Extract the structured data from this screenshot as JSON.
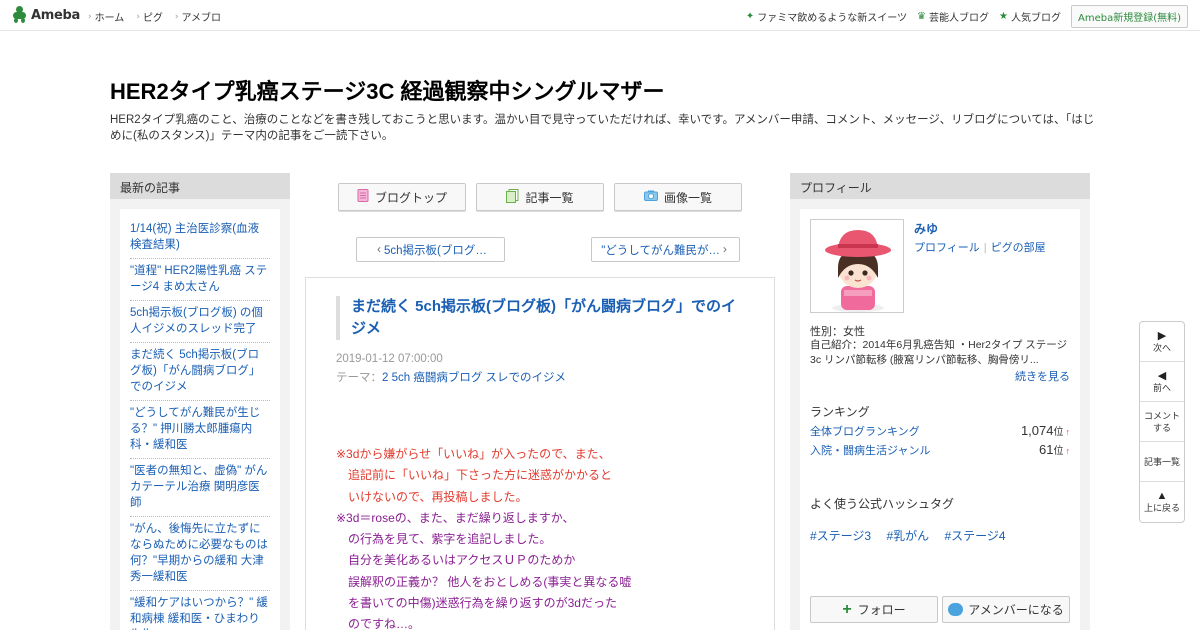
{
  "header": {
    "logo": "Ameba",
    "nav": [
      {
        "label": "ホーム"
      },
      {
        "label": "ピグ"
      },
      {
        "label": "アメブロ"
      }
    ],
    "right_links": [
      {
        "label": "ファミマ飲めるような新スイーツ",
        "icon": "sparkle-icon"
      },
      {
        "label": "芸能人ブログ",
        "icon": "crown-icon"
      },
      {
        "label": "人気ブログ",
        "icon": "star-icon"
      }
    ],
    "signup_label": "Ameba新規登録(無料)"
  },
  "blog": {
    "title": "HER2タイプ乳癌ステージ3C 経過観察中シングルマザー",
    "description": "HER2タイプ乳癌のこと、治療のことなどを書き残しておこうと思います。温かい目で見守っていただければ、幸いです。アメンバー申請、コメント、メッセージ、リブログについては、「はじめに(私のスタンス)」テーマ内の記事をご一読下さい。"
  },
  "sidebar_left": {
    "heading": "最新の記事",
    "items": [
      {
        "label": "1/14(祝) 主治医診察(血液検査結果)"
      },
      {
        "label": "\"道程\" HER2陽性乳癌 ステージ4 まめ太さん"
      },
      {
        "label": "5ch掲示板(ブログ板) の個人イジメのスレッド完了"
      },
      {
        "label": "まだ続く 5ch掲示板(ブログ板)「がん闘病ブログ」でのイジメ"
      },
      {
        "label": "\"どうしてがん難民が生じる？\" 押川勝太郎腫瘍内科・緩和医"
      },
      {
        "label": "\"医者の無知と、虚偽\" がんカテーテル治療 関明彦医師"
      },
      {
        "label": "\"がん、後悔先に立たずにならぬために必要なものは何？\"早期からの緩和 大津秀一緩和医"
      },
      {
        "label": "\"緩和ケアはいつから？\" 緩和病棟 緩和医・ひまわり先生"
      }
    ]
  },
  "toolbar": {
    "buttons": [
      {
        "label": "ブログトップ",
        "icon": "document-icon"
      },
      {
        "label": "記事一覧",
        "icon": "list-icon"
      },
      {
        "label": "画像一覧",
        "icon": "camera-icon"
      }
    ],
    "prev_label": "5ch掲示板(ブログ…",
    "next_label": "\"どうしてがん難民が…"
  },
  "article": {
    "title": "まだ続く 5ch掲示板(ブログ板)「がん闘病ブログ」でのイジメ",
    "date": "2019-01-12 07:00:00",
    "theme_prefix": "テーマ：",
    "theme": "2 5ch 癌闘病ブログ スレでのイジメ",
    "red_lines": [
      "※3dから嫌がらせ「いいね」が入ったので、また、",
      "　追記前に「いいね」下さった方に迷惑がかかると",
      "　いけないので、再投稿しました。"
    ],
    "purple_lines": [
      "※3d＝roseの、また、まだ繰り返しますか、",
      "　の行為を見て、紫字を追記しました。",
      "　自分を美化あるいはアクセスＵＰのためか",
      "　誤解釈の正義か？ 他人をおとしめる(事実と異なる嘘",
      "　を書いての中傷)迷惑行為を繰り返すのが3dだった",
      "　のですね…。"
    ],
    "colors": {
      "red": "#e23b2e",
      "purple": "#8b2093"
    }
  },
  "profile": {
    "heading": "プロフィール",
    "name": "みゆ",
    "link_profile": "プロフィール",
    "link_pig": "ピグの部屋",
    "gender": "性別：女性",
    "intro": "自己紹介：2014年6月乳癌告知 ・Her2タイプ ステージ3c リンパ節転移 (腋窩リンパ節転移、胸骨傍リ...",
    "more": "続きを見る",
    "ranking_heading": "ランキング",
    "rankings": [
      {
        "label": "全体ブログランキング",
        "value": "1,074",
        "unit": "位",
        "trend": "↑"
      },
      {
        "label": "入院・闘病生活ジャンル",
        "value": "61",
        "unit": "位",
        "trend": "↑"
      }
    ],
    "hashtag_heading": "よく使う公式ハッシュタグ",
    "hashtags": [
      "#ステージ3",
      "#乳がん",
      "#ステージ4"
    ],
    "follow_label": "フォロー",
    "amember_label": "アメンバーになる"
  },
  "side_nav": [
    {
      "label": "次へ",
      "icon": "play-icon"
    },
    {
      "label": "前へ",
      "icon": "back-icon"
    },
    {
      "label": "コメントする",
      "icon": ""
    },
    {
      "label": "記事一覧",
      "icon": ""
    },
    {
      "label": "上に戻る",
      "icon": "up-icon"
    }
  ]
}
